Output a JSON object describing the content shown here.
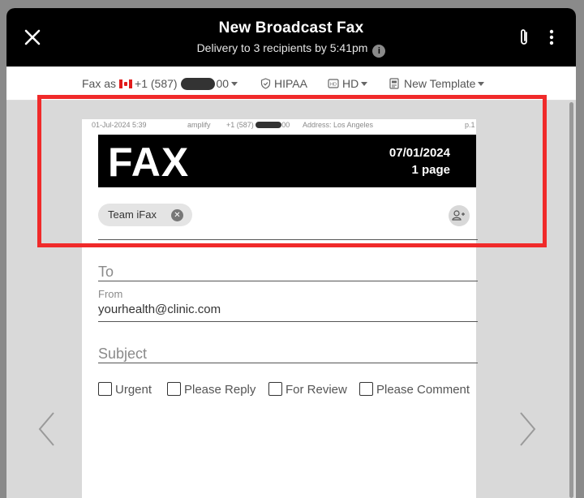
{
  "header": {
    "title": "New Broadcast Fax",
    "subtitle": "Delivery to 3 recipients by 5:41pm",
    "info_glyph": "i",
    "icons": [
      "close-icon",
      "paperclip-icon",
      "more-vert-icon"
    ]
  },
  "toolbar": {
    "fax_as_label": "Fax as",
    "phone_prefix": "+1 (587)",
    "phone_suffix": "00",
    "hipaa_label": "HIPAA",
    "quality_label": "HD",
    "template_label": "New Template"
  },
  "page_meta": {
    "date": "01-Jul-2024 5:39",
    "sender": "amplify",
    "phone_prefix": "+1 (587)",
    "phone_suffix": "00",
    "address": "Address: Los Angeles",
    "page_num": "p.1"
  },
  "cover": {
    "fax_word": "FAX",
    "date": "07/01/2024",
    "pages": "1 page",
    "recipient_chip": "Team iFax",
    "to_label": "To",
    "from_label": "From",
    "from_value": "yourhealth@clinic.com",
    "subject_label": "Subject",
    "checkboxes": [
      "Urgent",
      "Please Reply",
      "For Review",
      "Please Comment"
    ]
  },
  "colors": {
    "header_bg": "#000000",
    "highlight": "#f02a2a",
    "backdrop": "#8a8a8a"
  }
}
